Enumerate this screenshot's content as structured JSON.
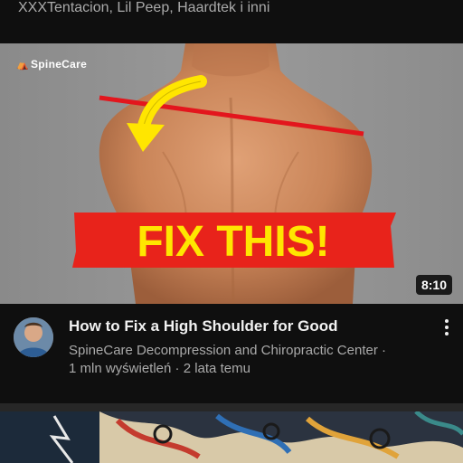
{
  "previous_item": {
    "subtitle": "XXXTentacion, Lil Peep, Haardtek i inni"
  },
  "video": {
    "brand": "SpineCare",
    "overlay_text": "FIX THIS!",
    "duration": "8:10",
    "title": "How to Fix a High Shoulder for Good",
    "channel": "SpineCare Decompression and Chiropractic Center ·",
    "views_age": "1 mln wyświetleń · 2 lata temu",
    "menu_icon": "kebab-menu-icon"
  },
  "colors": {
    "banner_red": "#e8231b",
    "banner_text": "#ffe600",
    "arrow_yellow": "#ffe600",
    "line_red": "#e3161d"
  }
}
